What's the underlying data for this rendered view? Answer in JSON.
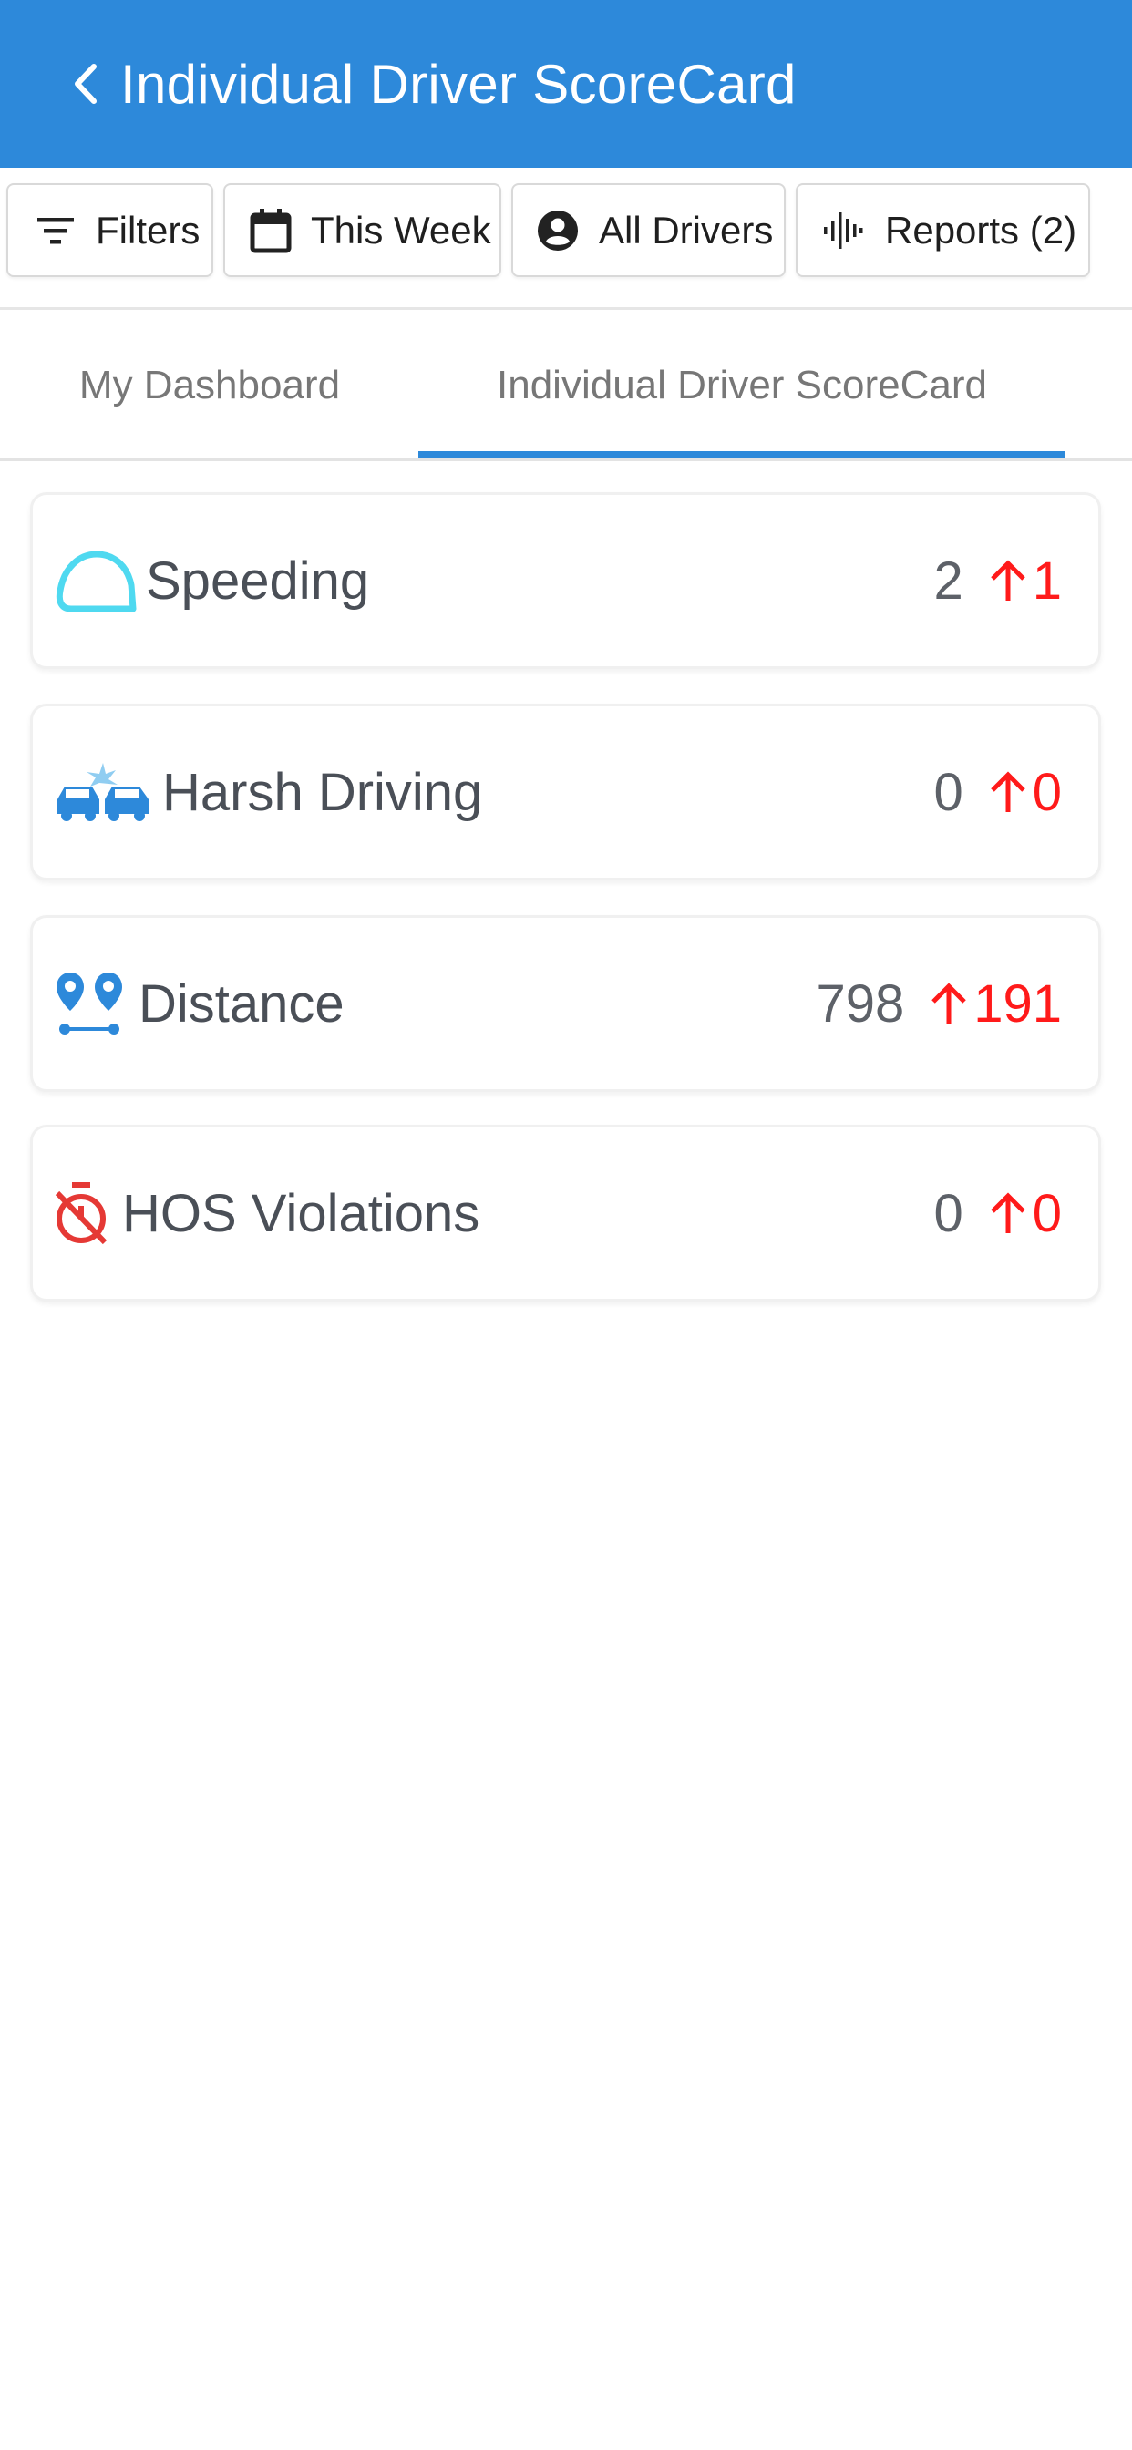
{
  "header": {
    "title": "Individual Driver ScoreCard",
    "background": "#2d89da",
    "back_icon": "chevron-left-icon"
  },
  "filters": {
    "filters_label": "Filters",
    "date_label": "This Week",
    "drivers_label": "All Drivers",
    "reports_label": "Reports (2)"
  },
  "tabs": [
    {
      "label": "My Dashboard",
      "active": false
    },
    {
      "label": "Individual Driver ScoreCard",
      "active": true
    }
  ],
  "metrics": [
    {
      "label": "Speeding",
      "value": "2",
      "change": "1",
      "icon": "speedometer-icon",
      "icon_color": "#4fd9f0"
    },
    {
      "label": "Harsh Driving",
      "value": "0",
      "change": "0",
      "icon": "car-crash-icon",
      "icon_color": "#2d89da"
    },
    {
      "label": "Distance",
      "value": "798",
      "change": "191",
      "icon": "route-pins-icon",
      "icon_color": "#2d89da"
    },
    {
      "label": "HOS Violations",
      "value": "0",
      "change": "0",
      "icon": "timer-off-icon",
      "icon_color": "#e53935"
    }
  ],
  "colors": {
    "accent": "#2d89da",
    "change_up": "#ff1a1a",
    "text_muted": "#777777"
  }
}
